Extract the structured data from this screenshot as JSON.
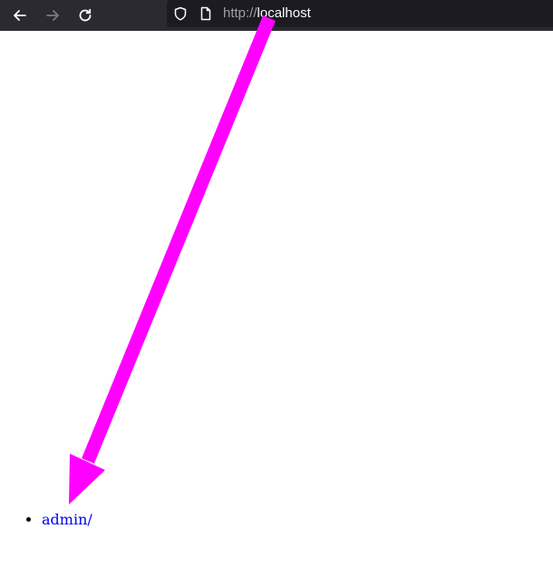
{
  "browser": {
    "url_scheme": "http://",
    "url_host": "localhost",
    "icons": {
      "back": "arrow-left-icon",
      "forward": "arrow-right-icon",
      "reload": "reload-icon",
      "site_info": "shield-icon",
      "page": "page-icon"
    },
    "forward_enabled": false
  },
  "page": {
    "listing": [
      {
        "label": "admin/"
      }
    ]
  },
  "annotation": {
    "type": "arrow",
    "color": "#ff00ff",
    "points_to": "admin/"
  }
}
